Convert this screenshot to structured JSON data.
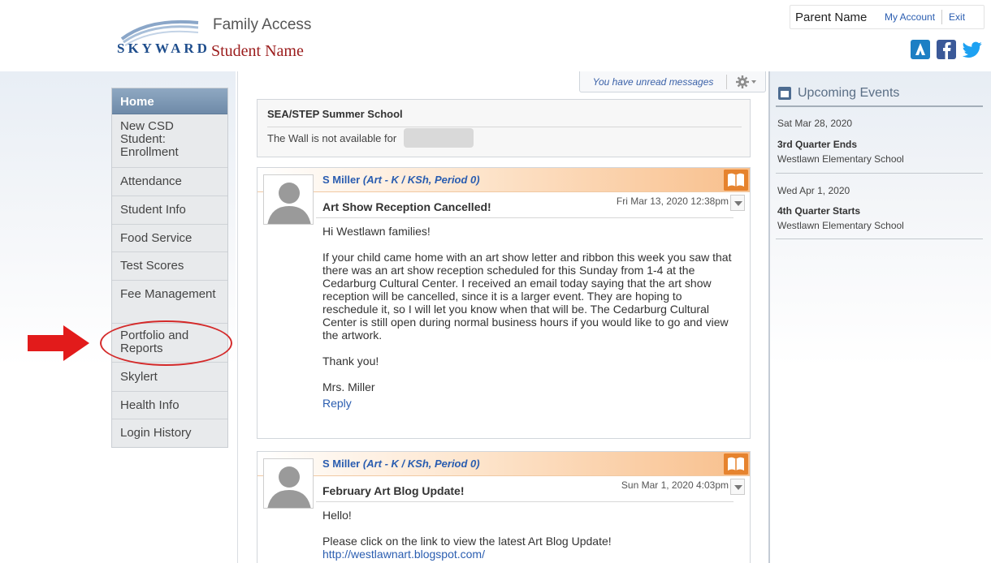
{
  "header": {
    "logo_text": "SKYWARD",
    "app_title": "Family Access",
    "student_name": "Student Name",
    "parent_name": "Parent Name",
    "my_account": "My Account",
    "exit": "Exit",
    "social_icons": [
      "family-access-app-icon",
      "facebook-icon",
      "twitter-icon"
    ]
  },
  "nav": {
    "items": [
      {
        "label": "Home"
      },
      {
        "label": "New CSD Student: Enrollment"
      },
      {
        "label": "Attendance"
      },
      {
        "label": "Student Info"
      },
      {
        "label": "Food Service"
      },
      {
        "label": "Test Scores"
      },
      {
        "label": "Fee Management"
      },
      {
        "label": "Portfolio and Reports"
      },
      {
        "label": "Skylert"
      },
      {
        "label": "Health Info"
      },
      {
        "label": "Login History"
      }
    ],
    "active": "Home",
    "highlighted": "Portfolio and Reports"
  },
  "messages": {
    "unread": "You have unread messages"
  },
  "wall": {
    "title": "SEA/STEP Summer School",
    "text": "The Wall is not available for"
  },
  "posts": [
    {
      "author": "S Miller",
      "class": "(Art - K / KSh, Period 0)",
      "title": "Art Show Reception Cancelled!",
      "date": "Fri Mar 13, 2020 12:38pm",
      "greeting": "Hi Westlawn families!",
      "body": "If your child came home with an art show letter and ribbon this week you saw that there was an art show reception scheduled for this Sunday from 1-4 at the Cedarburg Cultural Center. I received an email today saying that the art show reception will be cancelled, since it is a larger event. They are hoping to reschedule it, so I will let you know when that will be. The Cedarburg Cultural Center is still open during normal business hours if you would like to go and view the artwork.",
      "thanks": "Thank you!",
      "signature": "Mrs. Miller",
      "reply": "Reply"
    },
    {
      "author": "S Miller",
      "class": "(Art - K / KSh, Period 0)",
      "title": "February Art Blog Update!",
      "date": "Sun Mar 1, 2020 4:03pm",
      "greeting": "Hello!",
      "body": "Please click on the link to view the latest Art Blog Update!",
      "link": "http://westlawnart.blogspot.com/"
    }
  ],
  "events": {
    "title": "Upcoming Events",
    "items": [
      {
        "date": "Sat Mar 28, 2020",
        "name": "3rd Quarter Ends",
        "place": "Westlawn Elementary School"
      },
      {
        "date": "Wed Apr 1, 2020",
        "name": "4th Quarter Starts",
        "place": "Westlawn Elementary School"
      }
    ]
  },
  "colors": {
    "accent_blue": "#2a5db0",
    "student_red": "#9b1c1c",
    "annotation_red": "#d42a2a",
    "post_header_orange": "#f8bf8c"
  }
}
